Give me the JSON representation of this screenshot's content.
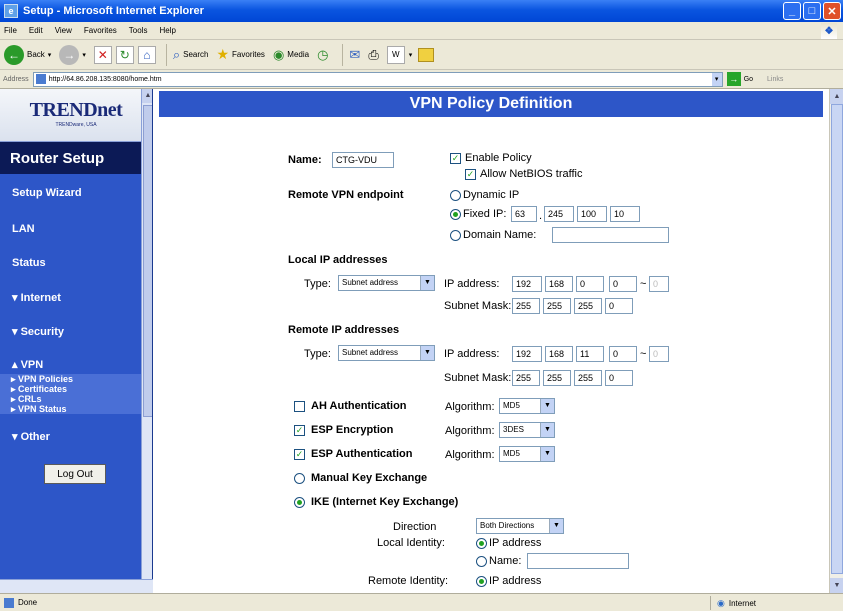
{
  "window": {
    "title": "Setup - Microsoft Internet Explorer"
  },
  "menu": [
    "File",
    "Edit",
    "View",
    "Favorites",
    "Tools",
    "Help"
  ],
  "toolbar": {
    "back": "Back",
    "search": "Search",
    "favorites": "Favorites",
    "media": "Media"
  },
  "address": {
    "label": "Address",
    "url": "http://64.86.208.135:8080/home.htm",
    "go": "Go",
    "links": "Links"
  },
  "sidebar": {
    "logo": "TRENDnet",
    "logo_sub": "TRENDware, USA",
    "router_setup": "Router Setup",
    "items": [
      "Setup Wizard",
      "LAN",
      "Status",
      "▾ Internet",
      "▾ Security",
      "▴ VPN",
      "▾ Other"
    ],
    "vpn_sub": [
      "▸ VPN Policies",
      "▸ Certificates",
      "▸ CRLs",
      "▸ VPN Status"
    ],
    "logout": "Log Out"
  },
  "page": {
    "title": "VPN Policy Definition",
    "name_label": "Name:",
    "name_value": "CTG-VDU",
    "enable_policy": "Enable Policy",
    "allow_netbios": "Allow NetBIOS traffic",
    "remote_endpoint": "Remote VPN endpoint",
    "dynamic_ip": "Dynamic IP",
    "fixed_ip": "Fixed IP:",
    "fixed_ip_octets": [
      "63",
      "245",
      "100",
      "10"
    ],
    "domain_name": "Domain Name:",
    "local_ip": "Local IP addresses",
    "type_label": "Type:",
    "type_value": "Subnet address",
    "ip_address_label": "IP address:",
    "local_ip_octets": [
      "192",
      "168",
      "0",
      "0"
    ],
    "range_end": "0",
    "subnet_label": "Subnet Mask:",
    "local_mask": [
      "255",
      "255",
      "255",
      "0"
    ],
    "remote_ip": "Remote IP addresses",
    "remote_ip_octets": [
      "192",
      "168",
      "11",
      "0"
    ],
    "remote_range_end": "0",
    "remote_mask": [
      "255",
      "255",
      "255",
      "0"
    ],
    "ah_auth": "AH Authentication",
    "esp_enc": "ESP Encryption",
    "esp_auth": "ESP Authentication",
    "algorithm_label": "Algorithm:",
    "ah_alg": "MD5",
    "esp_enc_alg": "3DES",
    "esp_auth_alg": "MD5",
    "manual_key": "Manual Key Exchange",
    "ike": "IKE (Internet Key Exchange)",
    "direction_label": "Direction",
    "direction_value": "Both Directions",
    "local_identity": "Local Identity:",
    "ip_address_opt": "IP address",
    "name_opt": "Name:",
    "remote_identity": "Remote Identity:"
  },
  "status": {
    "left": "Done",
    "zone": "Internet"
  }
}
